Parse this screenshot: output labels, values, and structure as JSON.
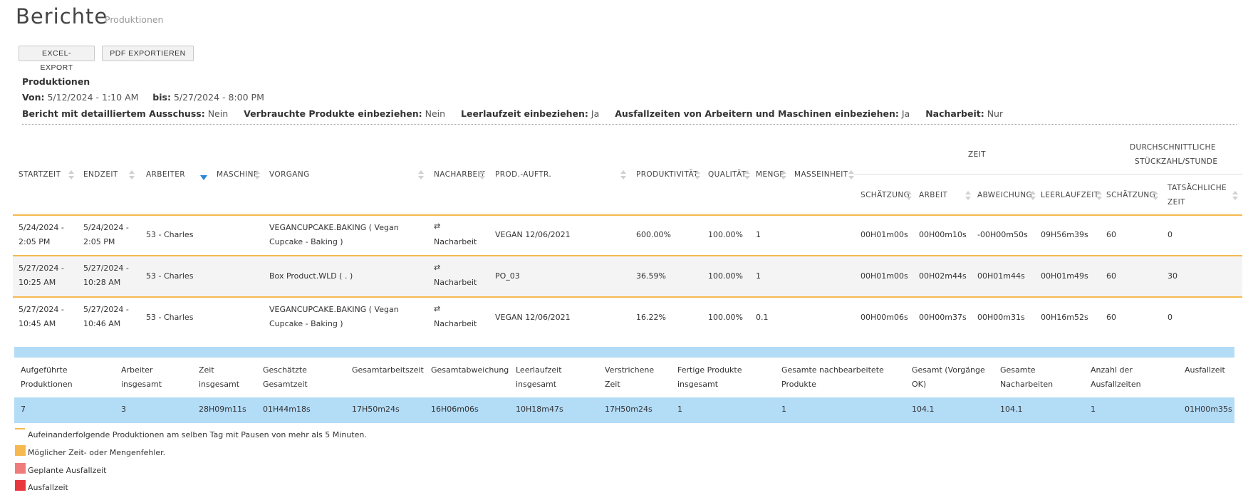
{
  "header": {
    "title": "Berichte",
    "subtitle": "Produktionen"
  },
  "toolbar": {
    "excel_label": "EXCEL-EXPORT",
    "pdf_label": "PDF EXPORTIEREN"
  },
  "filters": {
    "heading": "Produktionen",
    "von_label": "Von:",
    "von_value": "5/12/2024 - 1:10 AM",
    "bis_label": "bis:",
    "bis_value": "5/27/2024 - 8:00 PM",
    "items": [
      {
        "label": "Bericht mit detailliertem Ausschuss:",
        "value": "Nein"
      },
      {
        "label": "Verbrauchte Produkte einbeziehen:",
        "value": "Nein"
      },
      {
        "label": "Leerlaufzeit einbeziehen:",
        "value": "Ja"
      },
      {
        "label": "Ausfallzeiten von Arbeitern und Maschinen einbeziehen:",
        "value": "Ja"
      },
      {
        "label": "Nacharbeit:",
        "value": "Nur"
      }
    ]
  },
  "table": {
    "headers": {
      "startzeit": "STARTZEIT",
      "endzeit": "ENDZEIT",
      "arbeiter": "ARBEITER",
      "maschine": "MASCHINE",
      "vorgang": "VORGANG",
      "nacharbeit": "NACHARBEIT",
      "prod_auftr": "PROD.-AUFTR.",
      "produktivitaet": "PRODUKTIVITÄT",
      "qualitaet": "QUALITÄT",
      "menge": "MENGE",
      "masseinheit": "MASSEINHEIT",
      "zeit_group": "ZEIT",
      "stueck_group_1": "DURCHSCHNITTLICHE",
      "stueck_group_2": "STÜCKZAHL/STUNDE",
      "schaetzung": "SCHÄTZUNG",
      "arbeit": "ARBEIT",
      "abweichung": "ABWEICHUNG",
      "leerlaufzeit": "LEERLAUFZEIT",
      "schaetzung2": "SCHÄTZUNG",
      "tatsaechliche_1": "TATSÄCHLICHE",
      "tatsaechliche_2": "ZEIT"
    },
    "rows": [
      {
        "start_1": "5/24/2024 -",
        "start_2": "2:05 PM",
        "end_1": "5/24/2024 -",
        "end_2": "2:05 PM",
        "arbeiter": "53 - Charles",
        "vorgang_1": "VEGANCUPCAKE.BAKING ( Vegan",
        "vorgang_2": "Cupcake - Baking )",
        "nacharbeit": "Nacharbeit",
        "prod_auftr": "VEGAN 12/06/2021",
        "produktivitaet": "600.00%",
        "qualitaet": "100.00%",
        "menge": "1",
        "schaetzung": "00H01m00s",
        "arbeit": "00H00m10s",
        "abweichung": "-00H00m50s",
        "leerlaufzeit": "09H56m39s",
        "stk_schaetzung": "60",
        "stk_tats": "0"
      },
      {
        "start_1": "5/27/2024 -",
        "start_2": "10:25 AM",
        "end_1": "5/27/2024 -",
        "end_2": "10:28 AM",
        "arbeiter": "53 - Charles",
        "vorgang_1": "Box Product.WLD ( . )",
        "vorgang_2": "",
        "nacharbeit": "Nacharbeit",
        "prod_auftr": "PO_03",
        "produktivitaet": "36.59%",
        "qualitaet": "100.00%",
        "menge": "1",
        "schaetzung": "00H01m00s",
        "arbeit": "00H02m44s",
        "abweichung": "00H01m44s",
        "leerlaufzeit": "00H01m49s",
        "stk_schaetzung": "60",
        "stk_tats": "30"
      },
      {
        "start_1": "5/27/2024 -",
        "start_2": "10:45 AM",
        "end_1": "5/27/2024 -",
        "end_2": "10:46 AM",
        "arbeiter": "53 - Charles",
        "vorgang_1": "VEGANCUPCAKE.BAKING ( Vegan",
        "vorgang_2": "Cupcake - Baking )",
        "nacharbeit": "Nacharbeit",
        "prod_auftr": "VEGAN 12/06/2021",
        "produktivitaet": "16.22%",
        "qualitaet": "100.00%",
        "menge": "0.1",
        "schaetzung": "00H00m06s",
        "arbeit": "00H00m37s",
        "abweichung": "00H00m31s",
        "leerlaufzeit": "00H16m52s",
        "stk_schaetzung": "60",
        "stk_tats": "0"
      }
    ]
  },
  "summary": {
    "headers": [
      {
        "l1": "Aufgeführte",
        "l2": "Produktionen"
      },
      {
        "l1": "Arbeiter",
        "l2": "insgesamt"
      },
      {
        "l1": "Zeit",
        "l2": "insgesamt"
      },
      {
        "l1": "Geschätzte",
        "l2": "Gesamtzeit"
      },
      {
        "l1": "Gesamtarbeitszeit",
        "l2": ""
      },
      {
        "l1": "Gesamtabweichung",
        "l2": ""
      },
      {
        "l1": "Leerlaufzeit",
        "l2": "insgesamt"
      },
      {
        "l1": "Verstrichene",
        "l2": "Zeit"
      },
      {
        "l1": "Fertige Produkte",
        "l2": "insgesamt"
      },
      {
        "l1": "Gesamte nachbearbeitete",
        "l2": "Produkte"
      },
      {
        "l1": "Gesamt (Vorgänge",
        "l2": "OK)"
      },
      {
        "l1": "Gesamte",
        "l2": "Nacharbeiten"
      },
      {
        "l1": "Anzahl der",
        "l2": "Ausfallzeiten"
      },
      {
        "l1": "Ausfallzeit",
        "l2": ""
      }
    ],
    "values": [
      "7",
      "3",
      "28H09m11s",
      "01H44m18s",
      "17H50m24s",
      "16H06m06s",
      "10H18m47s",
      "17H50m24s",
      "1",
      "1",
      "104.1",
      "104.1",
      "1",
      "01H00m35s"
    ]
  },
  "legend": {
    "items": [
      {
        "text": "Aufeinanderfolgende Produktionen am selben Tag mit Pausen von mehr als 5 Minuten.",
        "color": "#f5b94f"
      },
      {
        "text": "Möglicher Zeit- oder Mengenfehler.",
        "color": "#f5b94f"
      },
      {
        "text": "Geplante Ausfallzeit",
        "color": "#f07b7b"
      },
      {
        "text": "Ausfallzeit",
        "color": "#e8383e"
      }
    ]
  },
  "colors": {
    "accent_orange": "#f5b94f",
    "summary_blue": "#b3dcf7",
    "negative_green": "#2e8b2e",
    "positive_red": "#e84040",
    "sort_blue": "#2a86d8"
  }
}
